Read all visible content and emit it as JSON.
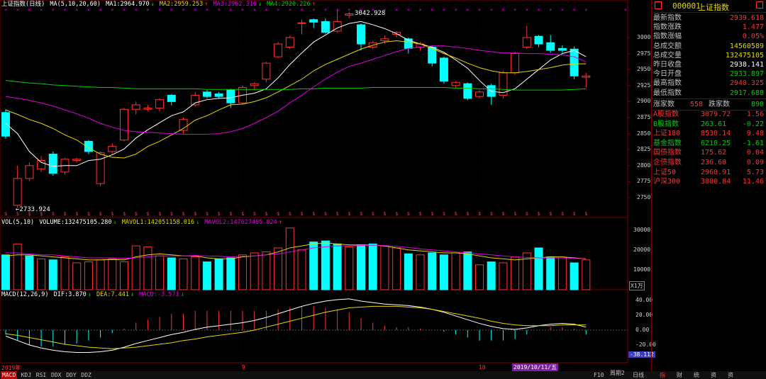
{
  "colors": {
    "up": "#ff3232",
    "down": "#00ffff",
    "ma1": "#ffffff",
    "ma2": "#e6d800",
    "ma3": "#e100e1",
    "ma4": "#00d000",
    "accent": "#ff3c3c",
    "dif": "#ffffff",
    "dea": "#e6d800"
  },
  "main_header": {
    "title": "上证指数(日线)",
    "ma_label": "MA(5,10,20,60)",
    "ma1": "MA1:2964.970",
    "ma1_arrow": "↓",
    "ma2": "MA2:2959.253",
    "ma2_arrow": "↑",
    "ma3": "MA3:2962.316",
    "ma3_arrow": "↓",
    "ma4": "MA4:2920.226",
    "ma4_arrow": "↑"
  },
  "vol_header": {
    "label": "VOL(5,10)",
    "volume": "VOLUME:132475105.280",
    "volume_arrow": "↓",
    "mavol1": "MAVOL1:142051158.016",
    "mavol1_arrow": "↓",
    "mavol2": "MAVOL2:147627405.824",
    "mavol2_arrow": "↑"
  },
  "macd_header": {
    "label": "MACD(12,26,9)",
    "dif": "DIF:3.870",
    "dif_arrow": "↓",
    "dea": "DEA:7.441",
    "dea_arrow": "↓",
    "macd": "MACD:-3.571",
    "macd_arrow": "↓"
  },
  "annotations": {
    "high": "3042.928",
    "low": "←2733.924"
  },
  "price_axis": [
    "3000",
    "2975",
    "2950",
    "2925",
    "2900",
    "2875",
    "2850",
    "2825",
    "2800",
    "2775",
    "2750"
  ],
  "vol_axis": [
    "30000",
    "20000",
    "10000"
  ],
  "vol_unit": "X1万",
  "macd_axis": [
    "40.00",
    "20.00",
    "0.00",
    "-20.00"
  ],
  "macd_current": "-38.112",
  "time_axis": {
    "start": "2019年",
    "m9": "9",
    "m10": "10",
    "current": "2019/10/11/五"
  },
  "chart_data": [
    {
      "type": "candlestick",
      "title": "上证指数(日线)",
      "ylim": [
        2725,
        3050
      ],
      "candles": [
        {
          "o": 2883,
          "c": 2846,
          "h": 2888,
          "l": 2842
        },
        {
          "o": 2738,
          "c": 2780,
          "h": 2800,
          "l": 2734
        },
        {
          "o": 2780,
          "c": 2800,
          "h": 2805,
          "l": 2776
        },
        {
          "o": 2795,
          "c": 2808,
          "h": 2815,
          "l": 2790
        },
        {
          "o": 2818,
          "c": 2788,
          "h": 2822,
          "l": 2784
        },
        {
          "o": 2790,
          "c": 2810,
          "h": 2812,
          "l": 2786
        },
        {
          "o": 2808,
          "c": 2810,
          "h": 2812,
          "l": 2805
        },
        {
          "o": 2838,
          "c": 2822,
          "h": 2840,
          "l": 2818
        },
        {
          "o": 2772,
          "c": 2820,
          "h": 2822,
          "l": 2768
        },
        {
          "o": 2822,
          "c": 2830,
          "h": 2835,
          "l": 2818
        },
        {
          "o": 2840,
          "c": 2888,
          "h": 2890,
          "l": 2838
        },
        {
          "o": 2888,
          "c": 2895,
          "h": 2900,
          "l": 2880
        },
        {
          "o": 2888,
          "c": 2890,
          "h": 2895,
          "l": 2885
        },
        {
          "o": 2890,
          "c": 2903,
          "h": 2905,
          "l": 2885
        },
        {
          "o": 2910,
          "c": 2900,
          "h": 2912,
          "l": 2894
        },
        {
          "o": 2855,
          "c": 2872,
          "h": 2875,
          "l": 2850
        },
        {
          "o": 2895,
          "c": 2910,
          "h": 2915,
          "l": 2892
        },
        {
          "o": 2915,
          "c": 2908,
          "h": 2918,
          "l": 2905
        },
        {
          "o": 2912,
          "c": 2908,
          "h": 2915,
          "l": 2905
        },
        {
          "o": 2918,
          "c": 2898,
          "h": 2920,
          "l": 2890
        },
        {
          "o": 2898,
          "c": 2922,
          "h": 2925,
          "l": 2895
        },
        {
          "o": 2925,
          "c": 2928,
          "h": 2930,
          "l": 2918
        },
        {
          "o": 2935,
          "c": 2960,
          "h": 2962,
          "l": 2930
        },
        {
          "o": 2970,
          "c": 2990,
          "h": 2993,
          "l": 2968
        },
        {
          "o": 2985,
          "c": 3000,
          "h": 3003,
          "l": 2982
        },
        {
          "o": 3023,
          "c": 3023,
          "h": 3028,
          "l": 3005
        },
        {
          "o": 3028,
          "c": 3024,
          "h": 3030,
          "l": 3015
        },
        {
          "o": 3025,
          "c": 3008,
          "h": 3030,
          "l": 3006
        },
        {
          "o": 3010,
          "c": 3025,
          "h": 3043,
          "l": 3008
        },
        {
          "o": 3035,
          "c": 3037,
          "h": 3040,
          "l": 3030
        },
        {
          "o": 3020,
          "c": 2990,
          "h": 3022,
          "l": 2980
        },
        {
          "o": 2985,
          "c": 2992,
          "h": 2995,
          "l": 2982
        },
        {
          "o": 2995,
          "c": 2998,
          "h": 3003,
          "l": 2990
        },
        {
          "o": 3005,
          "c": 3008,
          "h": 3010,
          "l": 3000
        },
        {
          "o": 2998,
          "c": 2983,
          "h": 3000,
          "l": 2975
        },
        {
          "o": 2985,
          "c": 2990,
          "h": 2993,
          "l": 2980
        },
        {
          "o": 2985,
          "c": 2960,
          "h": 2988,
          "l": 2955
        },
        {
          "o": 2968,
          "c": 2932,
          "h": 2970,
          "l": 2928
        },
        {
          "o": 2925,
          "c": 2930,
          "h": 2932,
          "l": 2920
        },
        {
          "o": 2928,
          "c": 2905,
          "h": 2930,
          "l": 2902
        },
        {
          "o": 2908,
          "c": 2915,
          "h": 2918,
          "l": 2905
        },
        {
          "o": 2925,
          "c": 2908,
          "h": 2928,
          "l": 2895
        },
        {
          "o": 2910,
          "c": 2945,
          "h": 2948,
          "l": 2905
        },
        {
          "o": 2945,
          "c": 2975,
          "h": 2978,
          "l": 2942
        },
        {
          "o": 2985,
          "c": 3000,
          "h": 3018,
          "l": 2982
        },
        {
          "o": 3002,
          "c": 2990,
          "h": 3004,
          "l": 2985
        },
        {
          "o": 2992,
          "c": 2980,
          "h": 3004,
          "l": 2976
        },
        {
          "o": 2983,
          "c": 2980,
          "h": 2988,
          "l": 2976
        },
        {
          "o": 2982,
          "c": 2940,
          "h": 2986,
          "l": 2935
        },
        {
          "o": 2938,
          "c": 2940,
          "h": 2945,
          "l": 2922
        }
      ],
      "ma1": [
        2866,
        2850,
        2822,
        2805,
        2799,
        2800,
        2800,
        2808,
        2810,
        2817,
        2826,
        2843,
        2856,
        2867,
        2878,
        2884,
        2898,
        2903,
        2905,
        2906,
        2910,
        2913,
        2920,
        2937,
        2958,
        2976,
        2993,
        3004,
        3015,
        3022,
        3025,
        3020,
        3014,
        3006,
        2996,
        2990,
        2985,
        2977,
        2965,
        2952,
        2933,
        2916,
        2914,
        2920,
        2935,
        2950,
        2965,
        2975,
        2980,
        2970
      ],
      "ma2": [
        2887,
        2880,
        2872,
        2866,
        2858,
        2848,
        2840,
        2828,
        2818,
        2813,
        2812,
        2818,
        2830,
        2838,
        2848,
        2858,
        2871,
        2878,
        2887,
        2895,
        2896,
        2900,
        2906,
        2915,
        2925,
        2935,
        2948,
        2958,
        2966,
        2974,
        2982,
        2988,
        2993,
        2995,
        2993,
        2990,
        2983,
        2975,
        2968,
        2960,
        2953,
        2948,
        2945,
        2945,
        2947,
        2950,
        2953,
        2957,
        2959,
        2959
      ],
      "ma3": [
        2908,
        2905,
        2902,
        2898,
        2893,
        2887,
        2881,
        2874,
        2866,
        2860,
        2855,
        2853,
        2852,
        2851,
        2850,
        2849,
        2849,
        2849,
        2850,
        2853,
        2858,
        2866,
        2875,
        2885,
        2898,
        2910,
        2923,
        2935,
        2946,
        2955,
        2960,
        2966,
        2972,
        2978,
        2983,
        2985,
        2987,
        2987,
        2985,
        2983,
        2980,
        2978,
        2976,
        2976,
        2975,
        2975,
        2974,
        2973,
        2970,
        2962
      ],
      "ma4": [
        2933,
        2931,
        2929,
        2928,
        2926,
        2925,
        2924,
        2923,
        2922,
        2922,
        2921,
        2920,
        2920,
        2920,
        2920,
        2920,
        2920,
        2919,
        2919,
        2919,
        2919,
        2919,
        2919,
        2919,
        2919,
        2920,
        2920,
        2921,
        2921,
        2921,
        2921,
        2922,
        2922,
        2922,
        2922,
        2922,
        2922,
        2922,
        2921,
        2921,
        2920,
        2920,
        2919,
        2918,
        2918,
        2918,
        2918,
        2918,
        2919,
        2920
      ]
    },
    {
      "type": "bar",
      "title": "VOL(5,10)",
      "ylabel": "X1万",
      "ylim": [
        0,
        32000
      ],
      "values": [
        17500,
        23000,
        17000,
        15500,
        15000,
        16500,
        13500,
        14000,
        15000,
        15500,
        14000,
        22000,
        21500,
        17000,
        16000,
        15500,
        16500,
        14000,
        15500,
        16000,
        17500,
        18500,
        19000,
        21000,
        31000,
        20000,
        24000,
        24500,
        23000,
        21500,
        22500,
        23000,
        22000,
        21000,
        18000,
        17500,
        18500,
        17500,
        18500,
        19000,
        12500,
        14000,
        13500,
        16500,
        18500,
        21000,
        16500,
        16000,
        13500,
        15000
      ],
      "up": [
        0,
        1,
        0,
        1,
        0,
        1,
        1,
        1,
        1,
        1,
        1,
        1,
        1,
        1,
        0,
        1,
        1,
        0,
        0,
        0,
        1,
        1,
        1,
        1,
        1,
        1,
        0,
        0,
        0,
        1,
        0,
        0,
        1,
        1,
        0,
        1,
        0,
        0,
        1,
        0,
        1,
        0,
        1,
        1,
        1,
        0,
        0,
        1,
        0,
        1
      ],
      "mavol1": [
        17000,
        17500,
        17500,
        17000,
        16500,
        16000,
        15500,
        15000,
        15000,
        15200,
        15000,
        16500,
        17500,
        18000,
        17500,
        17000,
        17000,
        16000,
        15500,
        15500,
        16500,
        17000,
        17500,
        19000,
        21000,
        22000,
        23000,
        23500,
        23000,
        22500,
        22500,
        22500,
        22000,
        21000,
        20000,
        19500,
        19000,
        18500,
        18500,
        18000,
        17000,
        16000,
        15500,
        15000,
        15500,
        16000,
        16500,
        16500,
        16000,
        15500
      ],
      "mavol2": [
        18500,
        18500,
        18000,
        17500,
        17500,
        17000,
        16500,
        16000,
        16000,
        16000,
        15800,
        16000,
        16500,
        17000,
        17000,
        17000,
        17200,
        17000,
        16800,
        16500,
        16800,
        17000,
        17500,
        18000,
        19000,
        20000,
        21000,
        21500,
        22000,
        22000,
        22200,
        22400,
        22200,
        21800,
        21200,
        20500,
        20000,
        19500,
        19000,
        18500,
        18000,
        17500,
        17000,
        16500,
        16200,
        16000,
        16000,
        16000,
        15800,
        15500
      ]
    },
    {
      "type": "line",
      "title": "MACD(12,26,9)",
      "ylim": [
        -40,
        50
      ],
      "dif": [
        -8,
        -14,
        -20,
        -24,
        -27,
        -29,
        -30,
        -30,
        -29,
        -27,
        -23,
        -18,
        -14,
        -10,
        -6,
        -3,
        1,
        4,
        6,
        8,
        10,
        13,
        17,
        22,
        27,
        32,
        36,
        39,
        41,
        42,
        39,
        37,
        35,
        34,
        33,
        31,
        28,
        24,
        19,
        14,
        9,
        5,
        2,
        1,
        3,
        6,
        8,
        9,
        8,
        4
      ],
      "dea": [
        -5,
        -7,
        -10,
        -13,
        -16,
        -19,
        -21,
        -23,
        -24,
        -25,
        -24,
        -23,
        -21,
        -19,
        -17,
        -14,
        -12,
        -9,
        -7,
        -5,
        -3,
        0,
        4,
        8,
        12,
        16,
        20,
        24,
        27,
        30,
        31,
        32,
        32,
        32,
        31,
        30,
        28,
        25,
        22,
        19,
        16,
        12,
        9,
        7,
        6,
        6,
        6,
        7,
        7,
        7
      ],
      "macd": [
        -6,
        -14,
        -20,
        -22,
        -22,
        -20,
        -18,
        -14,
        -10,
        -4,
        2,
        10,
        14,
        18,
        22,
        22,
        26,
        26,
        26,
        26,
        26,
        26,
        26,
        28,
        30,
        32,
        32,
        30,
        28,
        24,
        16,
        10,
        6,
        4,
        4,
        2,
        0,
        -2,
        -6,
        -10,
        -14,
        -14,
        -14,
        -12,
        -6,
        0,
        4,
        4,
        2,
        -6
      ]
    }
  ],
  "quote": {
    "code": "000001",
    "name": "上证指数",
    "rows": [
      {
        "label": "最新指数",
        "value": "2939.618",
        "color": "#ff3232"
      },
      {
        "label": "指数涨跌",
        "value": "1.477",
        "color": "#ff3232"
      },
      {
        "label": "指数涨幅",
        "value": "0.05%",
        "color": "#ff3232"
      },
      {
        "label": "总成交额",
        "value": "14560589",
        "color": "#e6d800"
      },
      {
        "label": "总成交量",
        "value": "132475105",
        "color": "#e6d800"
      },
      {
        "label": "昨日收盘",
        "value": "2938.141",
        "color": "#ffffff"
      },
      {
        "label": "今日开盘",
        "value": "2933.897",
        "color": "#00d000"
      },
      {
        "label": "最高指数",
        "value": "2940.325",
        "color": "#ff3232"
      },
      {
        "label": "最低指数",
        "value": "2917.688",
        "color": "#00d000"
      }
    ],
    "rise_label": "涨家数",
    "rise_value": "558",
    "fall_label": "跌家数",
    "fall_value": "890",
    "indices": [
      {
        "name": "A股指数",
        "price": "3079.72",
        "change": "1.56",
        "color": "#ff3232"
      },
      {
        "name": "B股指数",
        "price": "263.61",
        "change": "-0.22",
        "color": "#00d000"
      },
      {
        "name": "上证180",
        "price": "8530.14",
        "change": "9.48",
        "color": "#ff3232"
      },
      {
        "name": "基金指数",
        "price": "6210.25",
        "change": "-1.61",
        "color": "#00d000"
      },
      {
        "name": "国债指数",
        "price": "175.62",
        "change": "0.04",
        "color": "#ff3232"
      },
      {
        "name": "企债指数",
        "price": "236.68",
        "change": "0.09",
        "color": "#ff3232"
      },
      {
        "name": "上证50",
        "price": "2960.91",
        "change": "5.73",
        "color": "#ff3232"
      },
      {
        "name": "沪深300",
        "price": "3880.84",
        "change": "11.46",
        "color": "#ff3232"
      }
    ]
  },
  "bottom_tabs": {
    "left": [
      "MACD",
      "KDJ",
      "RSI",
      "DDX",
      "DDY",
      "DDZ"
    ],
    "f10": "F10",
    "week": "周期2",
    "period": "周期",
    "daily": "日线",
    "right": [
      "指",
      "财",
      "统",
      "资",
      "资"
    ]
  }
}
